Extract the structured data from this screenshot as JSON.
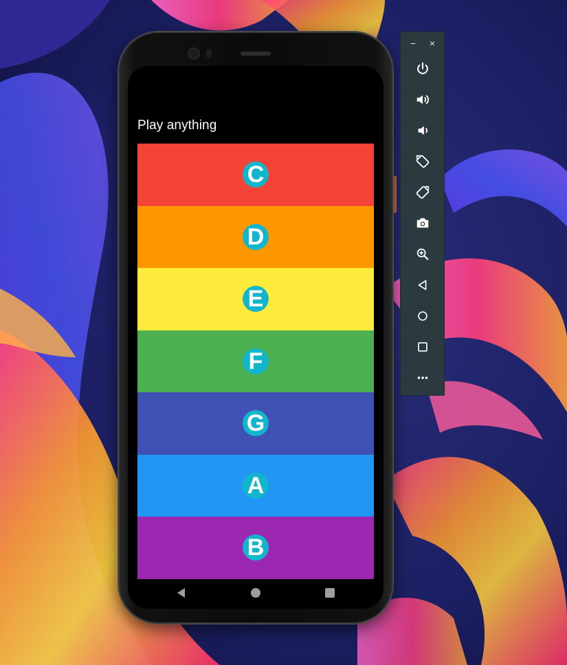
{
  "app": {
    "title": "Play anything"
  },
  "keys": [
    {
      "note": "C",
      "color": "#f44336"
    },
    {
      "note": "D",
      "color": "#ff9800"
    },
    {
      "note": "E",
      "color": "#ffeb3b"
    },
    {
      "note": "F",
      "color": "#4caf50"
    },
    {
      "note": "G",
      "color": "#3f51b5"
    },
    {
      "note": "A",
      "color": "#2196f3"
    },
    {
      "note": "B",
      "color": "#9c27b0"
    }
  ],
  "badge_color": "#12b6cc",
  "navigation": {
    "back_icon": "triangle-back-icon",
    "home_icon": "circle-home-icon",
    "recents_icon": "square-recents-icon"
  },
  "emulator_toolbar": {
    "minimize_label": "−",
    "close_label": "×",
    "buttons": [
      "power-icon",
      "volume-up-icon",
      "volume-down-icon",
      "rotate-left-icon",
      "rotate-right-icon",
      "camera-icon",
      "zoom-icon",
      "back-icon",
      "home-icon",
      "overview-icon",
      "more-icon"
    ]
  }
}
